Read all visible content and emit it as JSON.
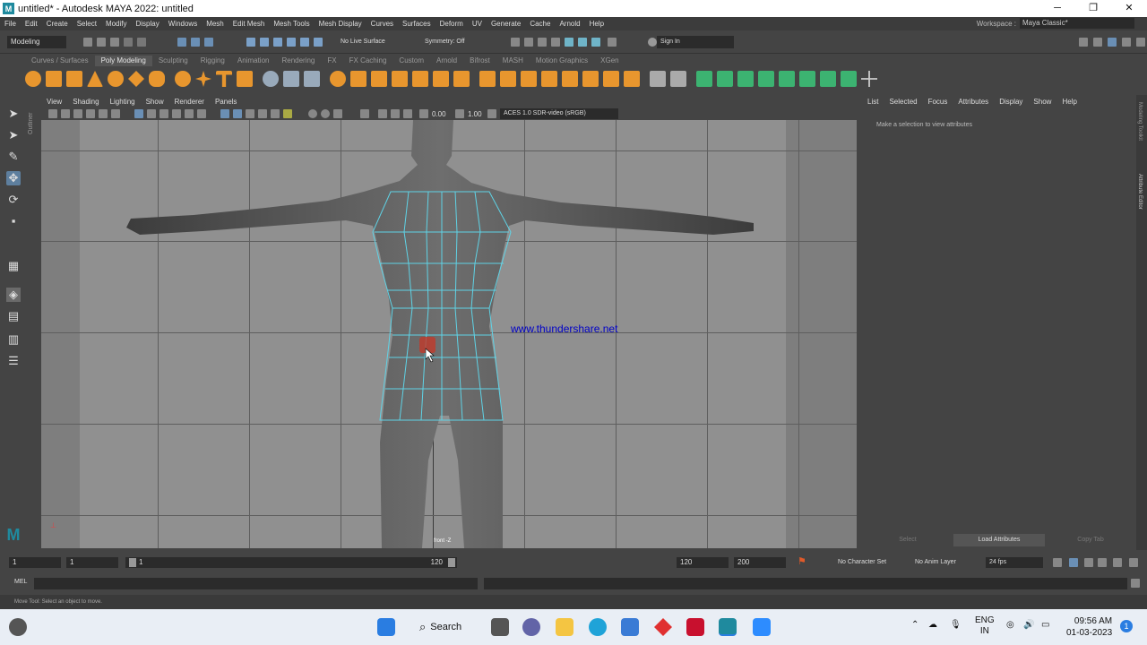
{
  "window": {
    "title": "untitled* - Autodesk MAYA 2022: untitled",
    "min": "─",
    "max": "❐",
    "close": "✕"
  },
  "menus": [
    "File",
    "Edit",
    "Create",
    "Select",
    "Modify",
    "Display",
    "Windows",
    "Mesh",
    "Edit Mesh",
    "Mesh Tools",
    "Mesh Display",
    "Curves",
    "Surfaces",
    "Deform",
    "UV",
    "Generate",
    "Cache",
    "Arnold",
    "Help"
  ],
  "workspace": {
    "label": "Workspace :",
    "value": "Maya Classic*"
  },
  "statusline": {
    "mode": "Modeling",
    "live_surface": "No Live Surface",
    "symmetry": "Symmetry: Off",
    "sign_in": "Sign In"
  },
  "shelf_tabs": [
    "Curves / Surfaces",
    "Poly Modeling",
    "Sculpting",
    "Rigging",
    "Animation",
    "Rendering",
    "FX",
    "FX Caching",
    "Custom",
    "Arnold",
    "Bifrost",
    "MASH",
    "Motion Graphics",
    "XGen"
  ],
  "shelf_active": "Poly Modeling",
  "outliner_tab": "Outliner",
  "panel_menus": [
    "View",
    "Shading",
    "Lighting",
    "Show",
    "Renderer",
    "Panels"
  ],
  "panel_tools": {
    "value_a": "0.00",
    "value_b": "1.00",
    "colorspace": "ACES 1.0 SDR-video (sRGB)"
  },
  "viewport": {
    "watermark": "www.thundershare.net",
    "camera": "front -Z"
  },
  "attribute_editor": {
    "menus": [
      "List",
      "Selected",
      "Focus",
      "Attributes",
      "Display",
      "Show",
      "Help"
    ],
    "hint": "Make a selection to view attributes",
    "buttons": [
      "Select",
      "Load Attributes",
      "Copy Tab"
    ]
  },
  "side_tabs": [
    "Modeling Toolkit",
    "Attribute Editor"
  ],
  "timeline": {
    "start": "1",
    "current": "1",
    "range_start": "1",
    "range_end": "120",
    "end_a": "120",
    "end_b": "200",
    "char_set": "No Character Set",
    "anim_layer": "No Anim Layer",
    "fps": "24 fps"
  },
  "command": {
    "lang": "MEL"
  },
  "help_line": "Move Tool: Select an object to move.",
  "taskbar": {
    "search": "Search",
    "lang_top": "ENG",
    "lang_bottom": "IN",
    "time": "09:56 AM",
    "date": "01-03-2023",
    "notif": "1"
  },
  "colors": {
    "accent_tab": "#555555",
    "watermark": "#0000c8",
    "maya_teal": "#1f8a9e"
  }
}
